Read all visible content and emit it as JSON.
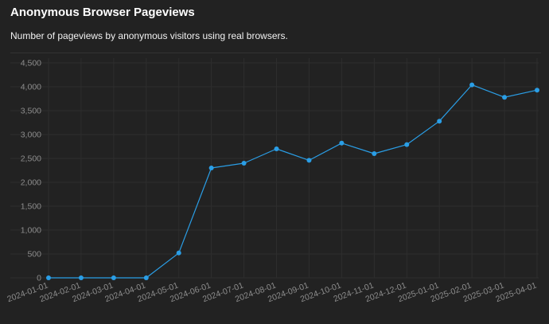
{
  "header": {
    "title": "Anonymous Browser Pageviews",
    "subtitle": "Number of pageviews by anonymous visitors using real browsers."
  },
  "colors": {
    "background": "#222222",
    "line": "#2a9ee6",
    "grid": "#2e2e2e",
    "tick_text": "#8c8c8c"
  },
  "chart_data": {
    "type": "line",
    "title": "",
    "xlabel": "",
    "ylabel": "",
    "ylim": [
      0,
      4500
    ],
    "yticks": [
      0,
      500,
      1000,
      1500,
      2000,
      2500,
      3000,
      3500,
      4000,
      4500
    ],
    "ytick_labels": [
      "0",
      "500",
      "1,000",
      "1,500",
      "2,000",
      "2,500",
      "3,000",
      "3,500",
      "4,000",
      "4,500"
    ],
    "grid": true,
    "legend": "none",
    "x": [
      "2024-01-01",
      "2024-02-01",
      "2024-03-01",
      "2024-04-01",
      "2024-05-01",
      "2024-06-01",
      "2024-07-01",
      "2024-08-01",
      "2024-09-01",
      "2024-10-01",
      "2024-11-01",
      "2024-12-01",
      "2025-01-01",
      "2025-02-01",
      "2025-03-01",
      "2025-04-01"
    ],
    "series": [
      {
        "values": [
          0,
          0,
          0,
          0,
          520,
          2300,
          2400,
          2700,
          2460,
          2820,
          2600,
          2790,
          3280,
          4040,
          3780,
          3930
        ]
      }
    ]
  }
}
